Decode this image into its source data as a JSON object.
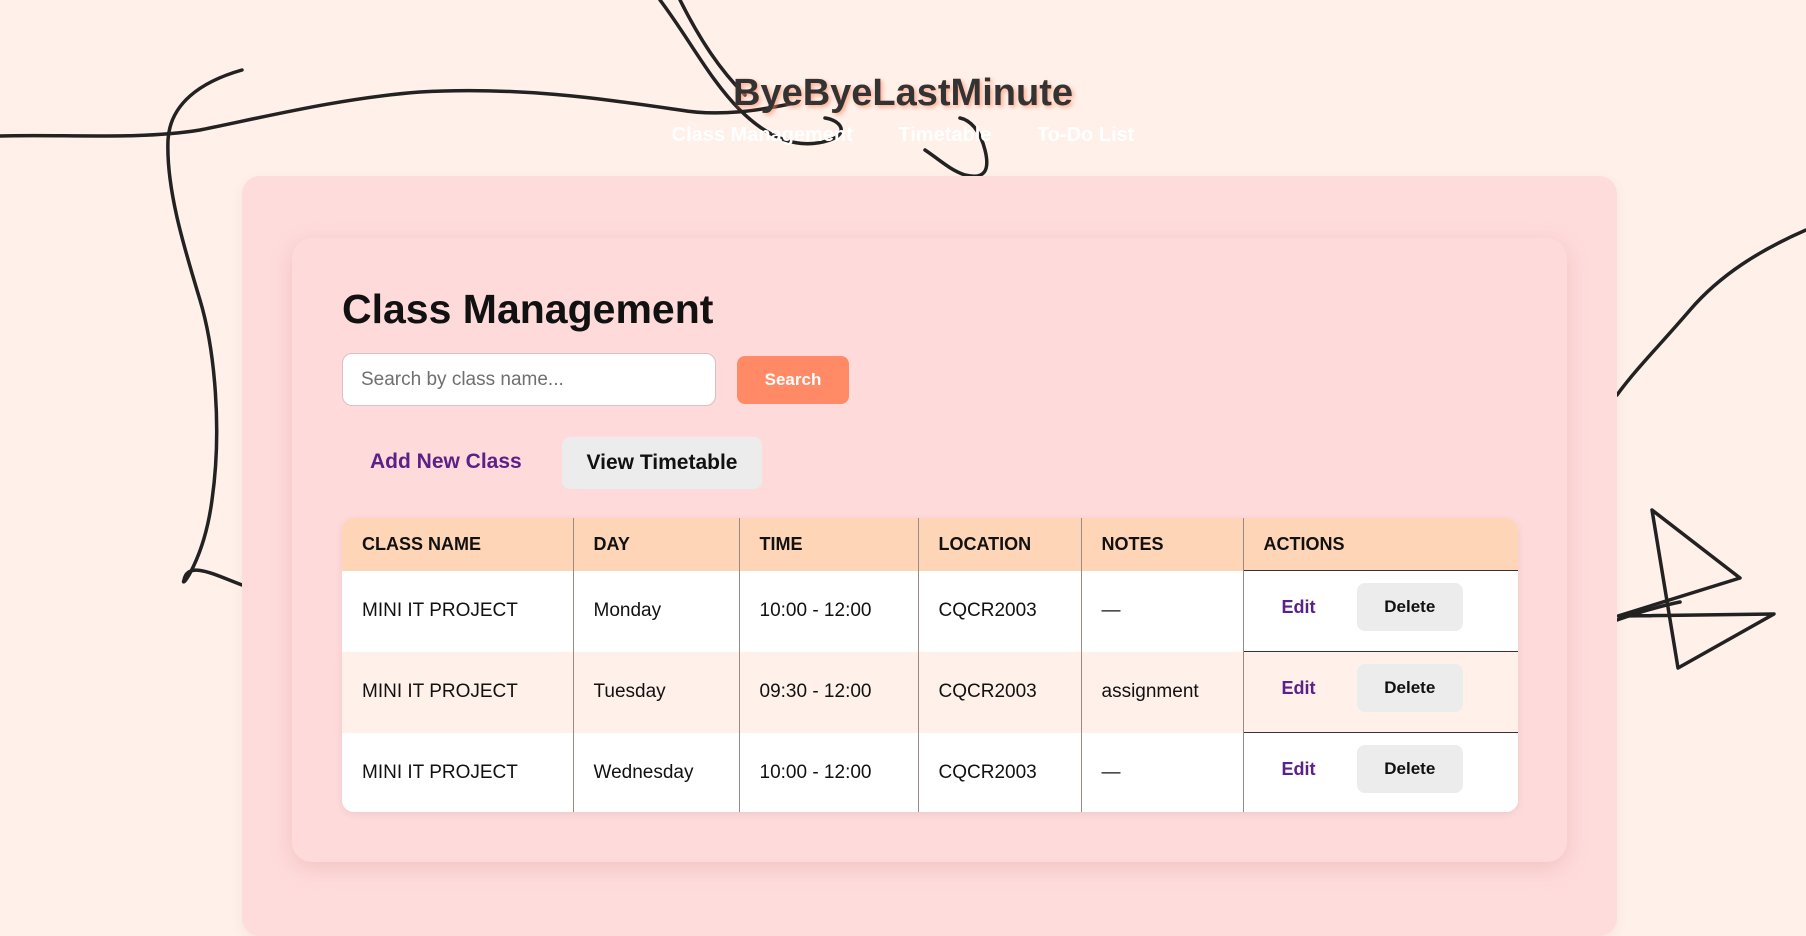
{
  "header": {
    "site_title": "ByeByeLastMinute",
    "nav": [
      {
        "label": "Class Management"
      },
      {
        "label": "Timetable"
      },
      {
        "label": "To-Do List"
      }
    ]
  },
  "main": {
    "page_title": "Class Management",
    "search": {
      "placeholder": "Search by class name...",
      "value": "",
      "button_label": "Search"
    },
    "add_class_label": "Add New Class",
    "view_timetable_label": "View Timetable",
    "table": {
      "columns": [
        "CLASS NAME",
        "DAY",
        "TIME",
        "LOCATION",
        "NOTES",
        "ACTIONS"
      ],
      "rows": [
        {
          "class_name": "MINI IT PROJECT",
          "day": "Monday",
          "time": "10:00 - 12:00",
          "location": "CQCR2003",
          "notes": "—",
          "edit_label": "Edit",
          "delete_label": "Delete"
        },
        {
          "class_name": "MINI IT PROJECT",
          "day": "Tuesday",
          "time": "09:30 - 12:00",
          "location": "CQCR2003",
          "notes": "assignment",
          "edit_label": "Edit",
          "delete_label": "Delete"
        },
        {
          "class_name": "MINI IT PROJECT",
          "day": "Wednesday",
          "time": "10:00 - 12:00",
          "location": "CQCR2003",
          "notes": "—",
          "edit_label": "Edit",
          "delete_label": "Delete"
        }
      ]
    }
  },
  "colors": {
    "page_background": "#fff1ea",
    "panel": "#ffdcdc",
    "accent": "#ff8a65",
    "table_header": "#ffd5b8",
    "link": "#5b2189"
  }
}
